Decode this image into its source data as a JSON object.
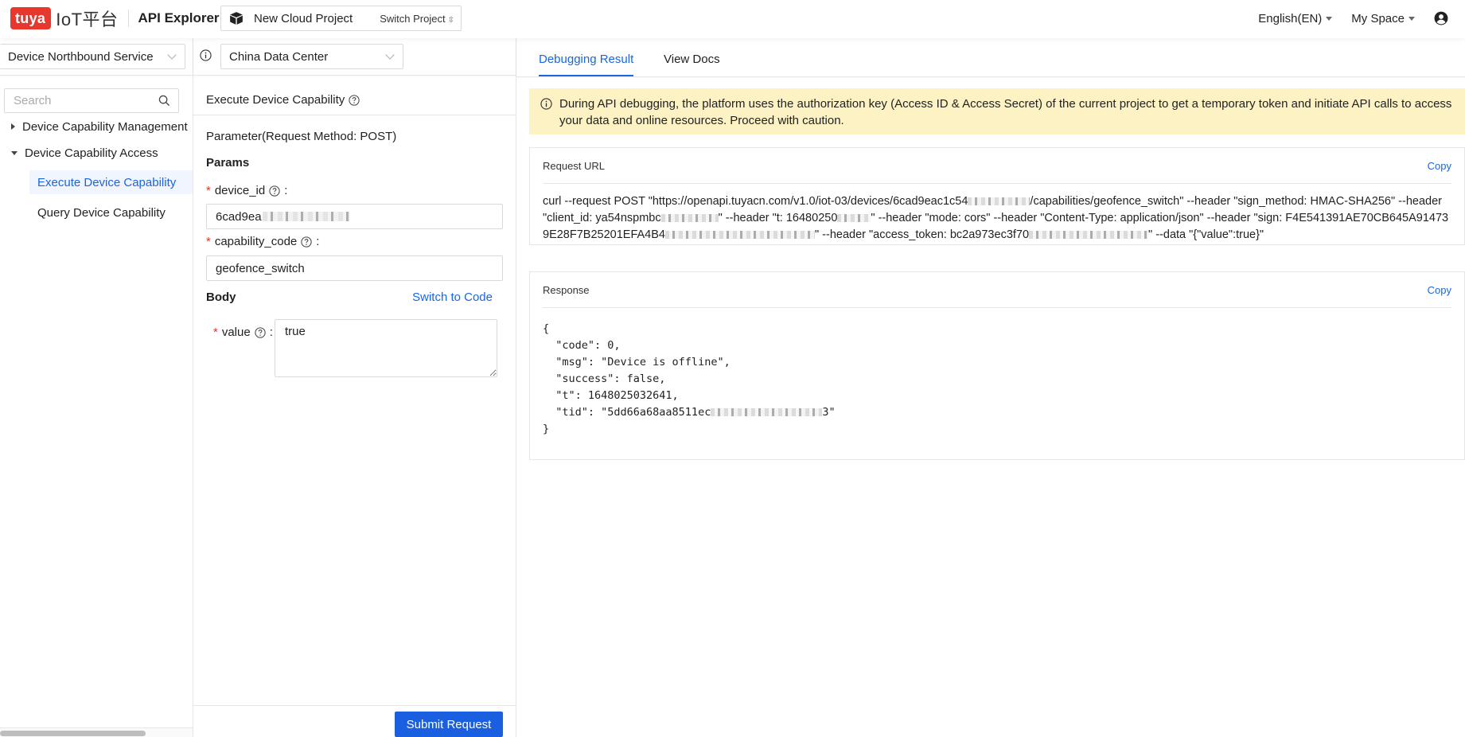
{
  "header": {
    "logo_badge": "tuya",
    "logo_text": "IoT平台",
    "app_title": "API Explorer",
    "project_name": "New Cloud Project",
    "switch_project": "Switch Project",
    "language": "English(EN)",
    "space": "My Space",
    "icons": {
      "project": "cube-icon",
      "user": "user-circle-icon"
    }
  },
  "sidebar": {
    "service_select": "Device Northbound Service",
    "search_placeholder": "Search",
    "tree": [
      {
        "label": "Device Capability Management",
        "expanded": false
      },
      {
        "label": "Device Capability Access",
        "expanded": true,
        "children": [
          {
            "label": "Execute Device Capability",
            "active": true
          },
          {
            "label": "Query Device Capability",
            "active": false
          }
        ]
      }
    ]
  },
  "middle": {
    "datacenter_select": "China Data Center",
    "api_title": "Execute Device Capability",
    "param_heading": "Parameter(Request Method: POST)",
    "params_label": "Params",
    "fields": [
      {
        "label": "device_id",
        "value": "6cad9ea",
        "required": true,
        "redacted": true
      },
      {
        "label": "capability_code",
        "value": "geofence_switch",
        "required": true,
        "redacted": false
      }
    ],
    "body_label": "Body",
    "switch_to_code": "Switch to Code",
    "body_field": {
      "label": "value",
      "value": "true",
      "required": true
    },
    "submit_label": "Submit Request"
  },
  "right": {
    "tabs": [
      {
        "label": "Debugging Result",
        "active": true
      },
      {
        "label": "View Docs",
        "active": false
      }
    ],
    "notice": "During API debugging, the platform uses the authorization key (Access ID & Access Secret) of the current project to get a temporary token and initiate API calls to access your data and online resources. Proceed with caution.",
    "request_url": {
      "title": "Request URL",
      "copy": "Copy",
      "parts": [
        "curl --request POST \"https://openapi.tuyacn.com/v1.0/iot-03/devices/6cad9eac1c54",
        "/capabilities/geofence_switch\" --header \"sign_method: HMAC-SHA256\" --header \"client_id: ya54nspmbc",
        "\" --header \"t: 16480250",
        "\" --header \"mode: cors\" --header \"Content-Type: application/json\" --header \"sign: F4E541391AE70CB645A914739E28F7B25201EFA4B4",
        "\" --header \"access_token: bc2a973ec3f70",
        "\" --data \"{\"value\":true}\""
      ]
    },
    "response": {
      "title": "Response",
      "copy": "Copy",
      "lines": [
        "{",
        "  \"code\": 0,",
        "  \"msg\": \"Device is offline\",",
        "  \"success\": false,",
        "  \"t\": 1648025032641,",
        "  \"tid\": \"5dd66a68aa8511ec",
        "}"
      ],
      "tid_suffix": "3\""
    }
  },
  "colors": {
    "brand_red": "#e8372c",
    "accent_blue": "#1a66e0",
    "notice_bg": "#fdf2c4",
    "required_red": "#e5322d"
  }
}
